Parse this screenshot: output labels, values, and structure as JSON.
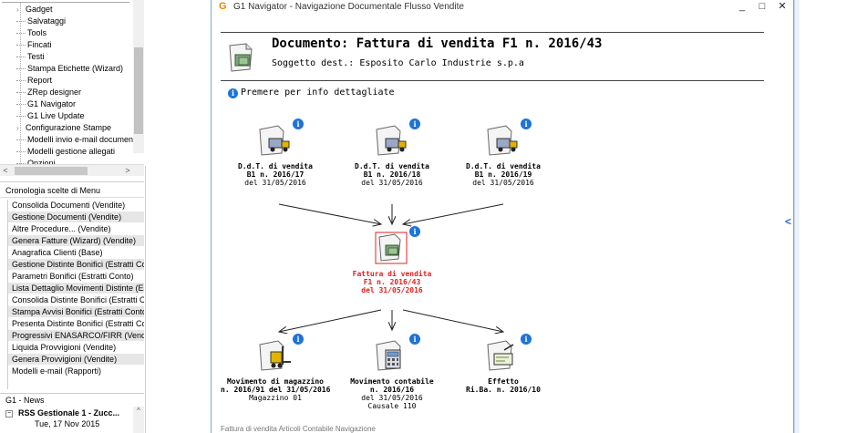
{
  "sidebar": {
    "tree_items": [
      {
        "label": "Gadget",
        "expand": true
      },
      {
        "label": "Salvataggi",
        "expand": false
      },
      {
        "label": "Tools",
        "expand": false
      },
      {
        "label": "Fincati",
        "expand": false
      },
      {
        "label": "Testi",
        "expand": false
      },
      {
        "label": "Stampa Etichette (Wizard)",
        "expand": false
      },
      {
        "label": "Report",
        "expand": false
      },
      {
        "label": "ZRep designer",
        "expand": false
      },
      {
        "label": "G1 Navigator",
        "expand": false
      },
      {
        "label": "G1 Live Update",
        "expand": false
      },
      {
        "label": "Configurazione Stampe",
        "expand": true
      },
      {
        "label": "Modelli invio e-mail documenti",
        "expand": false
      },
      {
        "label": "Modelli gestione allegati",
        "expand": false
      },
      {
        "label": "Opzioni",
        "expand": false
      }
    ],
    "scroll_left": "<",
    "scroll_right": ">",
    "cronologia_title": "Cronologia scelte di Menu",
    "cronologia_items": [
      "Consolida Documenti (Vendite)",
      "Gestione Documenti (Vendite)",
      "Altre Procedure... (Vendite)",
      "Genera Fatture (Wizard) (Vendite)",
      "Anagrafica Clienti (Base)",
      "Gestione Distinte Bonifici (Estratti Co",
      "Parametri Bonifici (Estratti Conto)",
      "Lista Dettaglio Movimenti Distinte (Es",
      "Consolida Distinte Bonifici (Estratti Co",
      "Stampa Avvisi Bonifici (Estratti Conto",
      "Presenta Distinte Bonifici (Estratti Co",
      "Progressivi ENASARCO/FIRR (Vendit",
      "Liquida Provvigioni (Vendite)",
      "Genera Provvigioni (Vendite)",
      "Modelli e-mail (Rapporti)"
    ],
    "news_title": "G1 - News",
    "news_item": "RSS Gestionale 1 - Zucc...",
    "news_box": "−",
    "news_date": "Tue, 17 Nov 2015",
    "news_scroll_up": "^"
  },
  "window": {
    "logo": "G",
    "title": "G1 Navigator - Navigazione Documentale Flusso Vendite",
    "minimize": "_",
    "maximize": "□",
    "close": "✕"
  },
  "document": {
    "title": "Documento: Fattura di vendita F1 n. 2016/43",
    "subtitle": "Soggetto dest.: Esposito Carlo Industrie s.p.a",
    "info_link": "Premere per info dettagliate",
    "info_glyph": "i"
  },
  "nodes": {
    "ddt1": {
      "type": "D.d.T. di vendita",
      "number": "B1 n. 2016/17",
      "date": "del 31/05/2016",
      "icon": "truck-document-icon"
    },
    "ddt2": {
      "type": "D.d.T. di vendita",
      "number": "B1 n. 2016/18",
      "date": "del 31/05/2016",
      "icon": "truck-document-icon"
    },
    "ddt3": {
      "type": "D.d.T. di vendita",
      "number": "B1 n. 2016/19",
      "date": "del 31/05/2016",
      "icon": "truck-document-icon"
    },
    "fattura": {
      "type": "Fattura di vendita",
      "number": "F1 n. 2016/43",
      "date": "del 31/05/2016",
      "icon": "invoice-icon"
    },
    "magazzino": {
      "type": "Movimento di magazzino",
      "number": "n. 2016/91 del 31/05/2016",
      "extra": "Magazzino 01",
      "icon": "forklift-icon"
    },
    "contabile": {
      "type": "Movimento contabile",
      "number": "n. 2016/16",
      "date": "del 31/05/2016",
      "extra": "Causale 110",
      "icon": "calculator-icon"
    },
    "effetto": {
      "type": "Effetto",
      "number": "Ri.Ba. n. 2016/10",
      "icon": "check-document-icon"
    }
  },
  "bottom_strip": "Fattura di vendita          Articoli                                                            Contabile          Navigazione",
  "colors": {
    "accent": "#1e73d6",
    "highlight_red": "#e02020",
    "window_border": "#7aa6d8",
    "logo_orange": "#e08a00"
  },
  "right_panel_chevron": "<",
  "content_scroll_up": "^",
  "content_scroll_down": "v"
}
